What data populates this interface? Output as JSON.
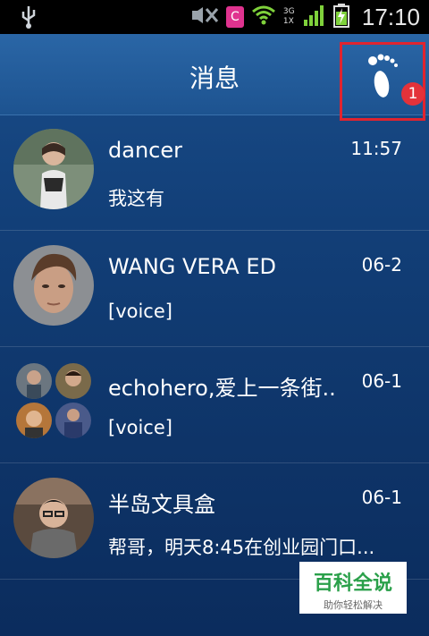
{
  "status_bar": {
    "time": "17:10",
    "network_label": "3G 1X",
    "notification_app": "C",
    "icons": [
      "usb-icon",
      "mute-icon",
      "notification-c-icon",
      "wifi-icon",
      "signal-icon",
      "battery-charging-icon"
    ]
  },
  "header": {
    "title": "消息",
    "badge_count": "1",
    "icon": "footprint-icon"
  },
  "conversations": [
    {
      "name": "dancer",
      "time": "11:57",
      "message": "我这有"
    },
    {
      "name": "WANG VERA ED",
      "time": "06-2",
      "message": "[voice]"
    },
    {
      "name": "echohero,爱上一条街..",
      "time": "06-1",
      "message": "[voice]"
    },
    {
      "name": "半岛文具盒",
      "time": "06-1",
      "message": "帮哥，明天8:45在创业园门口..."
    }
  ],
  "watermark": {
    "main": "百科全说",
    "sub": "助你轻松解决"
  },
  "colors": {
    "header_bg": "#1d5390",
    "list_bg": "#123f78",
    "badge": "#e4323a",
    "highlight_box": "#e0242f",
    "watermark_green": "#2aa04a"
  }
}
